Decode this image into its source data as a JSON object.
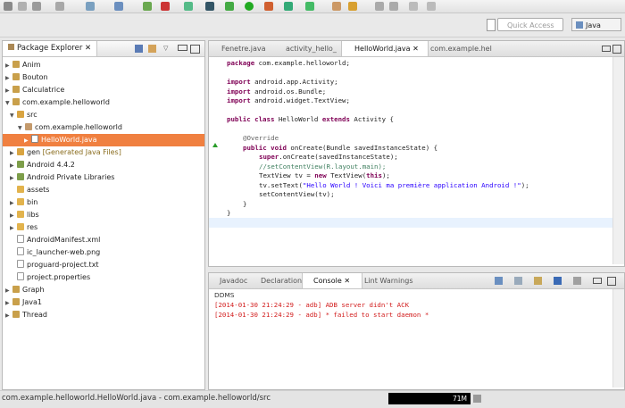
{
  "toolbar": {
    "quick_access_placeholder": "Quick Access",
    "perspective_label": "Java"
  },
  "package_explorer": {
    "title": "Package Explorer",
    "items": [
      {
        "label": "Anim",
        "extra": ""
      },
      {
        "label": "Bouton",
        "extra": ""
      },
      {
        "label": "Calculatrice",
        "extra": ""
      },
      {
        "label": "com.example.helloworld",
        "extra": ""
      },
      {
        "label": "src",
        "extra": ""
      },
      {
        "label": "com.example.helloworld",
        "extra": ""
      },
      {
        "label": "HelloWorld.java",
        "extra": ""
      },
      {
        "label": "gen",
        "extra": "[Generated Java Files]"
      },
      {
        "label": "Android 4.4.2",
        "extra": ""
      },
      {
        "label": "Android Private Libraries",
        "extra": ""
      },
      {
        "label": "assets",
        "extra": ""
      },
      {
        "label": "bin",
        "extra": ""
      },
      {
        "label": "libs",
        "extra": ""
      },
      {
        "label": "res",
        "extra": ""
      },
      {
        "label": "AndroidManifest.xml",
        "extra": ""
      },
      {
        "label": "ic_launcher-web.png",
        "extra": ""
      },
      {
        "label": "proguard-project.txt",
        "extra": ""
      },
      {
        "label": "project.properties",
        "extra": ""
      },
      {
        "label": "Graph",
        "extra": ""
      },
      {
        "label": "Java1",
        "extra": ""
      },
      {
        "label": "Thread",
        "extra": ""
      }
    ]
  },
  "editor": {
    "tabs": [
      "Fenetre.java",
      "activity_hello_",
      "HelloWorld.java",
      "com.example.hel"
    ],
    "code": {
      "l1": "com.example.helloworld;",
      "l3": "android.app.Activity;",
      "l4": "android.os.Bundle;",
      "l5": "android.widget.TextView;",
      "l7a": "HelloWorld",
      "l7b": "Activity {",
      "l9": "@Override",
      "l10": "onCreate(Bundle savedInstanceState) {",
      "l11": ".onCreate(savedInstanceState);",
      "l12": "//setContentView(R.layout.main);",
      "l13a": "TextView tv = ",
      "l13b": "TextView(",
      "l13c": ");",
      "l14a": "tv.setText(",
      "l14b": "\"Hello World ! Voici ma première application Android !\"",
      "l14c": ");",
      "l15": "setContentView(tv);",
      "l16": "}",
      "l17": "}"
    }
  },
  "console": {
    "tabs": [
      "Javadoc",
      "Declaration",
      "Console",
      "Lint Warnings"
    ],
    "title": "DDMS",
    "lines": [
      "[2014-01-30 21:24:29 - adb] ADB server didn't ACK",
      "[2014-01-30 21:24:29 - adb] * failed to start daemon *"
    ]
  },
  "status": {
    "text": "com.example.helloworld.HelloWorld.java - com.example.helloworld/src",
    "heap": "71M"
  }
}
